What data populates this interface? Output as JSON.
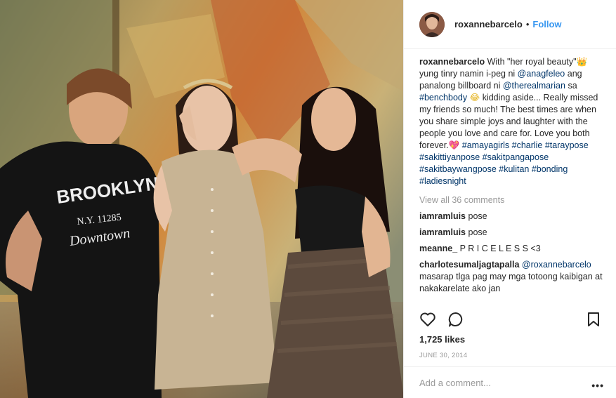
{
  "post": {
    "username": "roxannebarcelo",
    "follow_label": "Follow",
    "separator": "•",
    "photo_shirt_text": "BROOKLYN",
    "photo_shirt_sub": "N.Y. 11285",
    "photo_shirt_script": "Downtown"
  },
  "caption": {
    "username": "roxannebarcelo",
    "t1": " With \"her royal beauty\"",
    "crown": "👑",
    "t2": " yung tinry namin i-peg ni ",
    "mention1": "@anagfeleo",
    "t3": " ang panalong billboard ni ",
    "mention2": "@therealmarian",
    "t4": " sa ",
    "tag1": "#benchbody",
    "emoji": "😂",
    "t5": " kidding aside... Really missed my friends so much! The best times are when you share simple joys and laughter with the people you love and care for. Love you both forever.",
    "heart": "💖",
    "t6": " ",
    "tags": "#amayagirls #charlie #taraypose #sakittiyanpose #sakitpangapose #sakitbaywangpose #kulitan #bonding #ladiesnight"
  },
  "view_all": "View all 36 comments",
  "comments": [
    {
      "user": "iamramluis",
      "text": " pose"
    },
    {
      "user": "iamramluis",
      "text": " pose"
    },
    {
      "user": "meanne_",
      "text": " P R I C E L E S S <3"
    },
    {
      "user": "charlotesumaljagtapalla",
      "mention": " @roxannebarcelo",
      "text": " masarap tlga pag may mga totoong kaibigan at nakakarelate ako jan"
    }
  ],
  "icons": [
    "heart-outline-icon",
    "comment-bubble-icon",
    "bookmark-icon"
  ],
  "likes": "1,725 likes",
  "date": "JUNE 30, 2014",
  "add_comment": {
    "placeholder": "Add a comment..."
  },
  "more_label": "•••",
  "colors": {
    "link": "#3897f0",
    "hashtag": "#003569",
    "muted": "#999999",
    "text": "#262626"
  }
}
